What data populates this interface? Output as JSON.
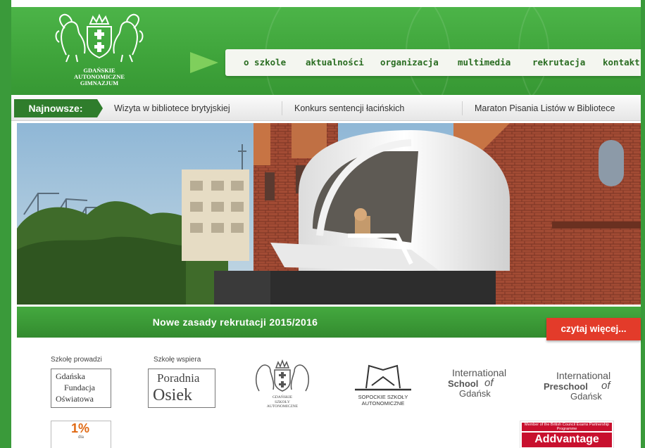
{
  "header": {
    "logo_lines": [
      "GDAŃSKIE",
      "AUTONOMICZNE",
      "GIMNAZJUM"
    ]
  },
  "nav": {
    "items": [
      "o szkole",
      "aktualności",
      "organizacja",
      "multimedia",
      "rekrutacja",
      "kontakt"
    ]
  },
  "ticker": {
    "label": "Najnowsze:",
    "items": [
      "Wizyta w bibliotece brytyjskiej",
      "Konkurs sentencji łacińskich",
      "Maraton Pisania Listów w Bibliotece"
    ]
  },
  "banner": {
    "title": "Nowe zasady rekrutacji 2015/2016",
    "button": "czytaj więcej..."
  },
  "sponsors": {
    "captions": {
      "runs": "Szkołę prowadzi",
      "supports": "Szkołę wspiera"
    },
    "gfo": {
      "line1": "Gdańska",
      "line2": "Fundacja",
      "line3": "Oświatowa"
    },
    "poradnia": {
      "line1": "Poradnia",
      "line2": "Osiek"
    },
    "gag_logo_lines": [
      "GDAŃSKIE",
      "SZKOŁY",
      "AUTONOMICZNE"
    ],
    "sopockie": {
      "line1": "SOPOCKIE SZKOŁY",
      "line2": "AUTONOMICZNE"
    },
    "isg": {
      "line1": "International",
      "line2": "School",
      "line3": "of",
      "line4": "Gdańsk"
    },
    "ipg": {
      "line1": "International",
      "line2": "Preschool",
      "line3": "of",
      "line4": "Gdańsk"
    },
    "one_percent": {
      "big": "1%",
      "small": "dla"
    },
    "addvantage": {
      "top": "Member of the British Council Exams Partnership Programme",
      "brand": "Addvantage"
    }
  },
  "colors": {
    "header_green": "#3ea33a",
    "nav_text": "#2a6d22",
    "ticker_label": "#2f7d2c",
    "button_red": "#e33b2a"
  }
}
